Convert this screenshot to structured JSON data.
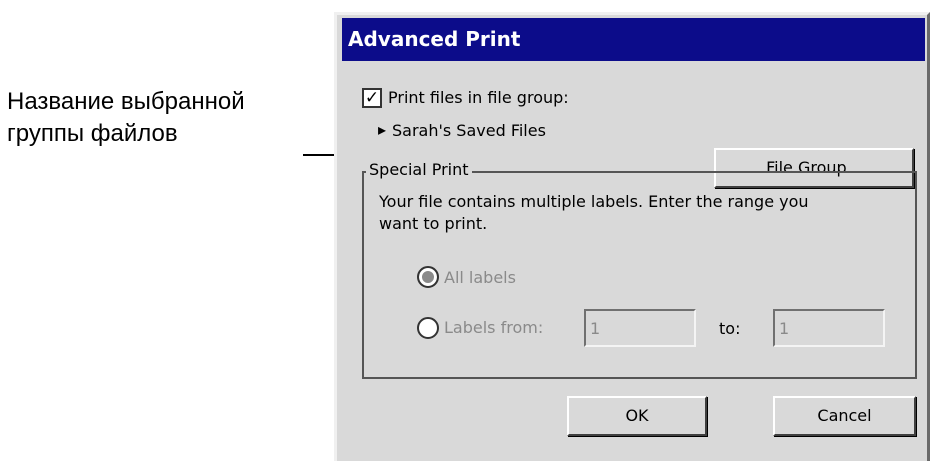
{
  "annotation": {
    "line1": "Название выбранной",
    "line2": "группы файлов"
  },
  "dialog": {
    "title": "Advanced Print",
    "print_files_checkbox": {
      "label": "Print files in file group:",
      "checked": true
    },
    "file_group_name": "Sarah's Saved Files",
    "file_group_button": "File Group...",
    "special_print": {
      "legend": "Special Print",
      "description_line1": "Your file contains multiple labels. Enter the range you",
      "description_line2": "want to print.",
      "all_labels": {
        "label": "All labels",
        "selected": true
      },
      "labels_from": {
        "label": "Labels from:",
        "selected": false,
        "from_value": "1",
        "to_label": "to:",
        "to_value": "1"
      }
    },
    "ok_button": "OK",
    "cancel_button": "Cancel"
  },
  "colors": {
    "title_bar": "#0c0c8a",
    "dialog_background": "#d9d9d9",
    "disabled_text": "#8a8a8a"
  }
}
